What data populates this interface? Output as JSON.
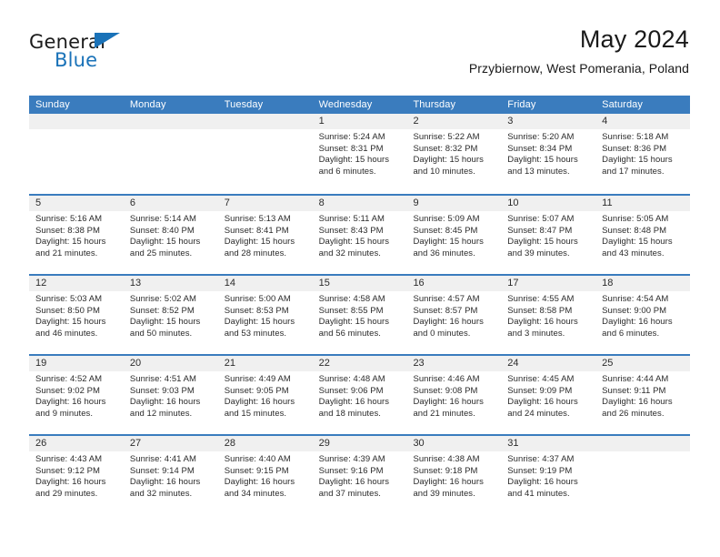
{
  "brand": {
    "name_top": "General",
    "name_bottom": "Blue",
    "accent_color": "#1a72b8"
  },
  "header": {
    "title": "May 2024",
    "location": "Przybiernow, West Pomerania, Poland"
  },
  "calendar": {
    "header_color": "#3a7cbe",
    "weekdays": [
      "Sunday",
      "Monday",
      "Tuesday",
      "Wednesday",
      "Thursday",
      "Friday",
      "Saturday"
    ],
    "weeks": [
      [
        {
          "day": "",
          "lines": []
        },
        {
          "day": "",
          "lines": []
        },
        {
          "day": "",
          "lines": []
        },
        {
          "day": "1",
          "lines": [
            "Sunrise: 5:24 AM",
            "Sunset: 8:31 PM",
            "Daylight: 15 hours",
            "and 6 minutes."
          ]
        },
        {
          "day": "2",
          "lines": [
            "Sunrise: 5:22 AM",
            "Sunset: 8:32 PM",
            "Daylight: 15 hours",
            "and 10 minutes."
          ]
        },
        {
          "day": "3",
          "lines": [
            "Sunrise: 5:20 AM",
            "Sunset: 8:34 PM",
            "Daylight: 15 hours",
            "and 13 minutes."
          ]
        },
        {
          "day": "4",
          "lines": [
            "Sunrise: 5:18 AM",
            "Sunset: 8:36 PM",
            "Daylight: 15 hours",
            "and 17 minutes."
          ]
        }
      ],
      [
        {
          "day": "5",
          "lines": [
            "Sunrise: 5:16 AM",
            "Sunset: 8:38 PM",
            "Daylight: 15 hours",
            "and 21 minutes."
          ]
        },
        {
          "day": "6",
          "lines": [
            "Sunrise: 5:14 AM",
            "Sunset: 8:40 PM",
            "Daylight: 15 hours",
            "and 25 minutes."
          ]
        },
        {
          "day": "7",
          "lines": [
            "Sunrise: 5:13 AM",
            "Sunset: 8:41 PM",
            "Daylight: 15 hours",
            "and 28 minutes."
          ]
        },
        {
          "day": "8",
          "lines": [
            "Sunrise: 5:11 AM",
            "Sunset: 8:43 PM",
            "Daylight: 15 hours",
            "and 32 minutes."
          ]
        },
        {
          "day": "9",
          "lines": [
            "Sunrise: 5:09 AM",
            "Sunset: 8:45 PM",
            "Daylight: 15 hours",
            "and 36 minutes."
          ]
        },
        {
          "day": "10",
          "lines": [
            "Sunrise: 5:07 AM",
            "Sunset: 8:47 PM",
            "Daylight: 15 hours",
            "and 39 minutes."
          ]
        },
        {
          "day": "11",
          "lines": [
            "Sunrise: 5:05 AM",
            "Sunset: 8:48 PM",
            "Daylight: 15 hours",
            "and 43 minutes."
          ]
        }
      ],
      [
        {
          "day": "12",
          "lines": [
            "Sunrise: 5:03 AM",
            "Sunset: 8:50 PM",
            "Daylight: 15 hours",
            "and 46 minutes."
          ]
        },
        {
          "day": "13",
          "lines": [
            "Sunrise: 5:02 AM",
            "Sunset: 8:52 PM",
            "Daylight: 15 hours",
            "and 50 minutes."
          ]
        },
        {
          "day": "14",
          "lines": [
            "Sunrise: 5:00 AM",
            "Sunset: 8:53 PM",
            "Daylight: 15 hours",
            "and 53 minutes."
          ]
        },
        {
          "day": "15",
          "lines": [
            "Sunrise: 4:58 AM",
            "Sunset: 8:55 PM",
            "Daylight: 15 hours",
            "and 56 minutes."
          ]
        },
        {
          "day": "16",
          "lines": [
            "Sunrise: 4:57 AM",
            "Sunset: 8:57 PM",
            "Daylight: 16 hours",
            "and 0 minutes."
          ]
        },
        {
          "day": "17",
          "lines": [
            "Sunrise: 4:55 AM",
            "Sunset: 8:58 PM",
            "Daylight: 16 hours",
            "and 3 minutes."
          ]
        },
        {
          "day": "18",
          "lines": [
            "Sunrise: 4:54 AM",
            "Sunset: 9:00 PM",
            "Daylight: 16 hours",
            "and 6 minutes."
          ]
        }
      ],
      [
        {
          "day": "19",
          "lines": [
            "Sunrise: 4:52 AM",
            "Sunset: 9:02 PM",
            "Daylight: 16 hours",
            "and 9 minutes."
          ]
        },
        {
          "day": "20",
          "lines": [
            "Sunrise: 4:51 AM",
            "Sunset: 9:03 PM",
            "Daylight: 16 hours",
            "and 12 minutes."
          ]
        },
        {
          "day": "21",
          "lines": [
            "Sunrise: 4:49 AM",
            "Sunset: 9:05 PM",
            "Daylight: 16 hours",
            "and 15 minutes."
          ]
        },
        {
          "day": "22",
          "lines": [
            "Sunrise: 4:48 AM",
            "Sunset: 9:06 PM",
            "Daylight: 16 hours",
            "and 18 minutes."
          ]
        },
        {
          "day": "23",
          "lines": [
            "Sunrise: 4:46 AM",
            "Sunset: 9:08 PM",
            "Daylight: 16 hours",
            "and 21 minutes."
          ]
        },
        {
          "day": "24",
          "lines": [
            "Sunrise: 4:45 AM",
            "Sunset: 9:09 PM",
            "Daylight: 16 hours",
            "and 24 minutes."
          ]
        },
        {
          "day": "25",
          "lines": [
            "Sunrise: 4:44 AM",
            "Sunset: 9:11 PM",
            "Daylight: 16 hours",
            "and 26 minutes."
          ]
        }
      ],
      [
        {
          "day": "26",
          "lines": [
            "Sunrise: 4:43 AM",
            "Sunset: 9:12 PM",
            "Daylight: 16 hours",
            "and 29 minutes."
          ]
        },
        {
          "day": "27",
          "lines": [
            "Sunrise: 4:41 AM",
            "Sunset: 9:14 PM",
            "Daylight: 16 hours",
            "and 32 minutes."
          ]
        },
        {
          "day": "28",
          "lines": [
            "Sunrise: 4:40 AM",
            "Sunset: 9:15 PM",
            "Daylight: 16 hours",
            "and 34 minutes."
          ]
        },
        {
          "day": "29",
          "lines": [
            "Sunrise: 4:39 AM",
            "Sunset: 9:16 PM",
            "Daylight: 16 hours",
            "and 37 minutes."
          ]
        },
        {
          "day": "30",
          "lines": [
            "Sunrise: 4:38 AM",
            "Sunset: 9:18 PM",
            "Daylight: 16 hours",
            "and 39 minutes."
          ]
        },
        {
          "day": "31",
          "lines": [
            "Sunrise: 4:37 AM",
            "Sunset: 9:19 PM",
            "Daylight: 16 hours",
            "and 41 minutes."
          ]
        },
        {
          "day": "",
          "lines": []
        }
      ]
    ]
  }
}
